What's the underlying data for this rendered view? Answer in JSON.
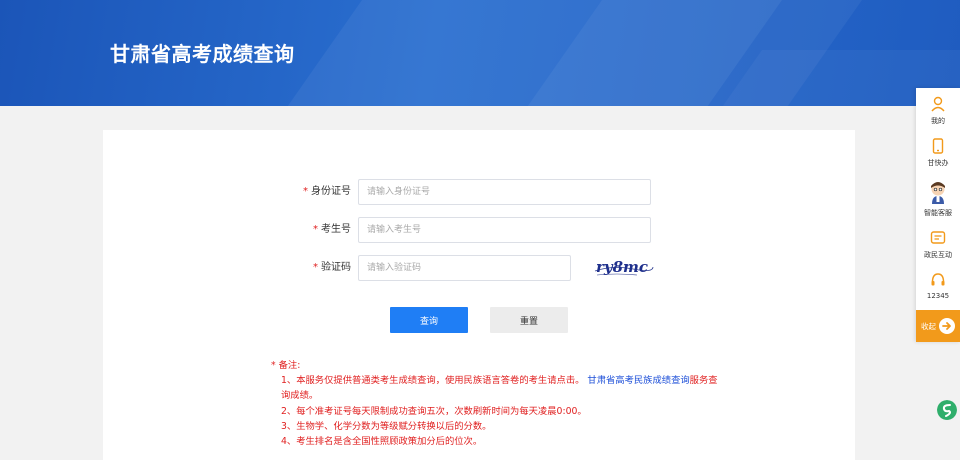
{
  "header": {
    "title": "甘肃省高考成绩查询"
  },
  "form": {
    "id_label": "身份证号",
    "id_placeholder": "请输入身份证号",
    "exam_label": "考生号",
    "exam_placeholder": "请输入考生号",
    "captcha_label": "验证码",
    "captcha_placeholder": "请输入验证码",
    "captcha_text": "ry8mc",
    "required_mark": "*"
  },
  "buttons": {
    "query": "查询",
    "reset": "重置"
  },
  "notes": {
    "head": "* 备注:",
    "line1_a": "1、本服务仅提供普通类考生成绩查询，使用民族语言答卷的考生请点击。",
    "line1_link": "甘肃省高考民族成绩查询",
    "line1_b": "服务查询成绩。",
    "line2": "2、每个准考证号每天限制成功查询五次，次数刷新时间为每天凌晨0:00。",
    "line3": "3、生物学、化学分数为等级赋分转换以后的分数。",
    "line4": "4、考生排名是含全国性照顾政策加分后的位次。"
  },
  "sidebar": {
    "mine": "我的",
    "gankuaiban": "甘快办",
    "assistant": "智能客服",
    "interaction": "政民互动",
    "hotline": "12345",
    "collapse": "收起"
  },
  "colors": {
    "brand": "#1f5cc0",
    "primary_button": "#1f7ef5",
    "warning": "#e02020",
    "accent": "#f29a1b"
  }
}
